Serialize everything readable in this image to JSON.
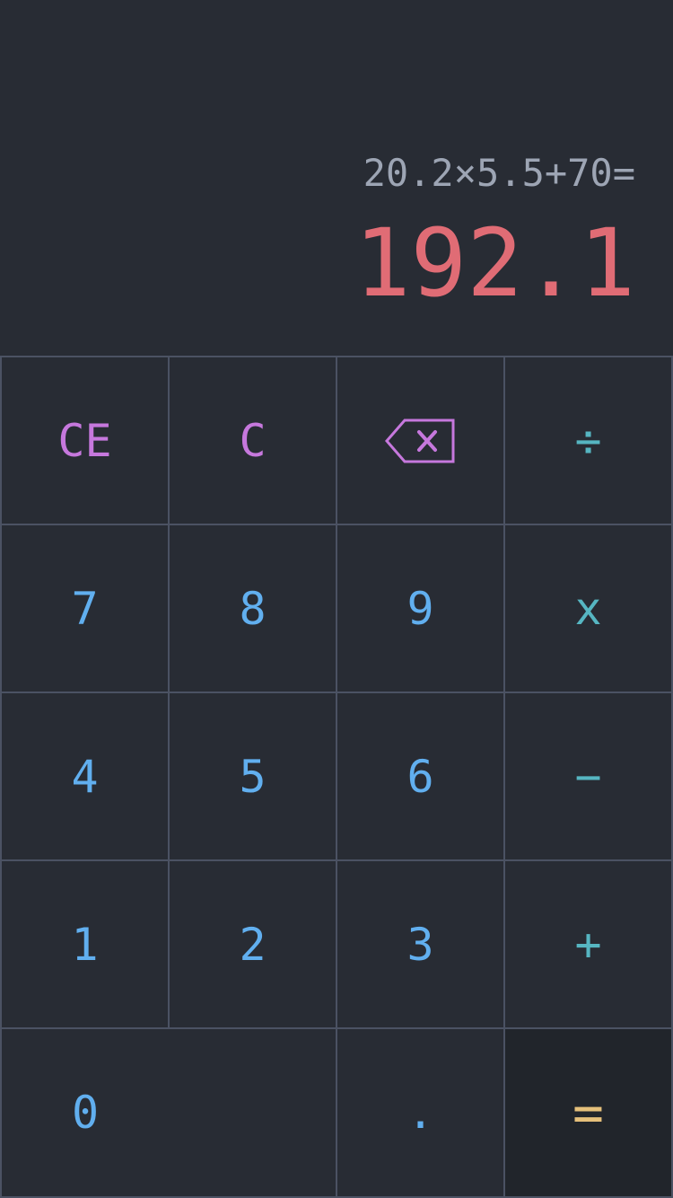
{
  "display": {
    "expression": "20.2×5.5+70=",
    "result": "192.1"
  },
  "keys": {
    "ce": "CE",
    "c": "C",
    "backspace_icon": "backspace-icon",
    "divide": "÷",
    "seven": "7",
    "eight": "8",
    "nine": "9",
    "multiply": "x",
    "four": "4",
    "five": "5",
    "six": "6",
    "minus": "−",
    "one": "1",
    "two": "2",
    "three": "3",
    "plus": "+",
    "zero": "0",
    "dot": ".",
    "equals": "="
  },
  "colors": {
    "background": "#282c34",
    "grid_lines": "#4b5263",
    "expression": "#9da5b4",
    "result": "#e06c75",
    "digits": "#61afef",
    "functions": "#c678dd",
    "operators": "#56b6c2",
    "equals": "#e5c07b",
    "equals_background": "#21252b"
  }
}
